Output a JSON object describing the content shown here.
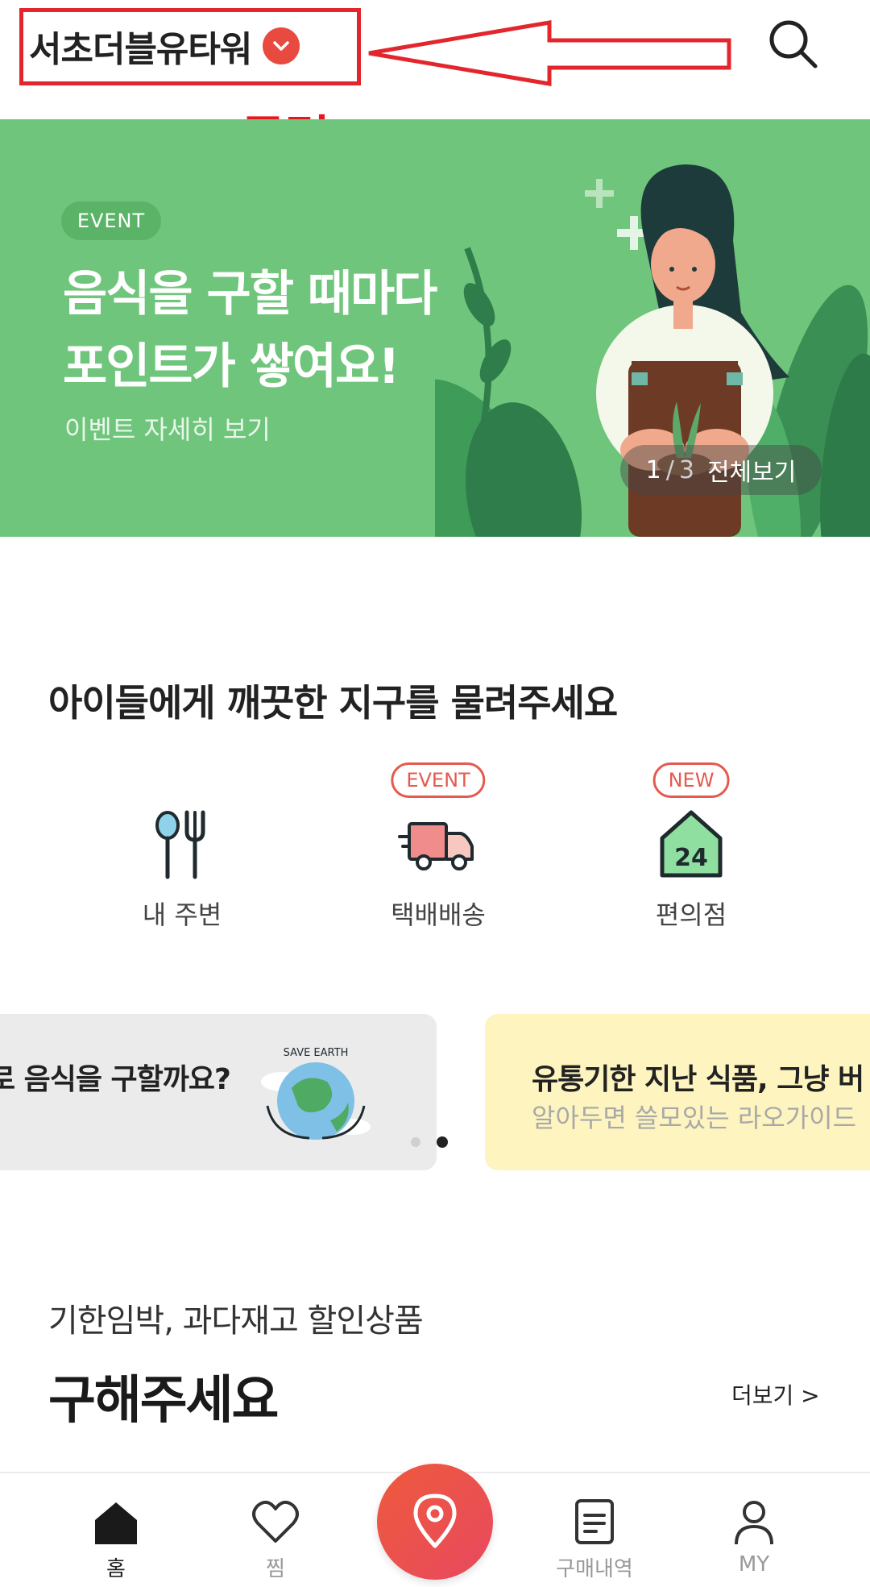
{
  "header": {
    "location": "서초더블유타워",
    "annotation_label": "클릭"
  },
  "banner": {
    "badge": "EVENT",
    "title_line1": "음식을 구할 때마다",
    "title_line2": "포인트가 쌓여요!",
    "subtitle": "이벤트 자세히 보기",
    "page_current": "1",
    "page_separator": "/",
    "page_total": "3",
    "view_all": "전체보기",
    "bg_color": "#6fc57b"
  },
  "section": {
    "title": "아이들에게 깨끗한 지구를 물려주세요"
  },
  "categories": [
    {
      "label": "내 주변",
      "badge": "",
      "icon": "fork-spoon-icon"
    },
    {
      "label": "택배배송",
      "badge": "EVENT",
      "icon": "truck-icon"
    },
    {
      "label": "편의점",
      "badge": "NEW",
      "icon": "convenience-store-24-icon",
      "icon_text": "24"
    }
  ],
  "cards": {
    "card1_text": "로 음식을 구할까요?",
    "card1_art_text": "SAVE EARTH",
    "card2_title": "유통기한 지난 식품, 그냥 버",
    "card2_sub": "알아두면 쓸모있는 라오가이드",
    "dots_active_index": 1
  },
  "discount": {
    "subtitle": "기한임박, 과다재고 할인상품",
    "title": "구해주세요",
    "more": "더보기 >"
  },
  "bottom_nav": [
    {
      "label": "홈",
      "icon": "home-icon",
      "active": true
    },
    {
      "label": "찜",
      "icon": "heart-icon",
      "active": false
    },
    {
      "label": "",
      "icon": "location-pin-icon",
      "active": false
    },
    {
      "label": "구매내역",
      "icon": "receipt-icon",
      "active": false
    },
    {
      "label": "MY",
      "icon": "user-icon",
      "active": false
    }
  ],
  "colors": {
    "accent": "#e84a3f",
    "annotation_red": "#e2262c",
    "badge_red": "#e45a4f"
  }
}
